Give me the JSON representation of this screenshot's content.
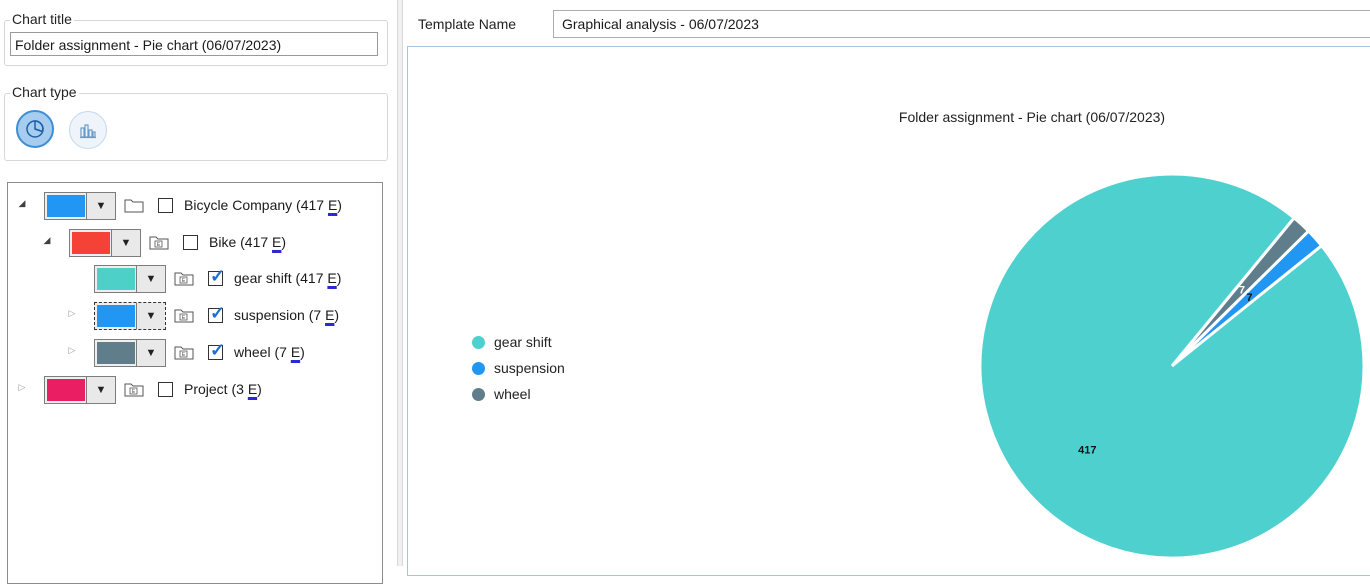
{
  "chart_title_group": {
    "label": "Chart title",
    "value": "Folder assignment - Pie chart (06/07/2023)"
  },
  "chart_type_group": {
    "label": "Chart type",
    "options": [
      {
        "name": "pie",
        "icon": "pie-chart-icon",
        "selected": true
      },
      {
        "name": "bar",
        "icon": "bar-chart-icon",
        "selected": false
      }
    ]
  },
  "tree": {
    "items": [
      {
        "label": "Bicycle Company (417 ",
        "e": "E",
        "close": ")",
        "color": "#2196F3",
        "expander": "expanded",
        "checked": false,
        "icon": "folder-icon"
      },
      {
        "label": "Bike (417 ",
        "e": "E",
        "close": ")",
        "color": "#F44336",
        "expander": "expanded",
        "checked": false,
        "icon": "folder-e-icon"
      },
      {
        "label": "gear shift (417 ",
        "e": "E",
        "close": ")",
        "color": "#4DD0C8",
        "expander": "none",
        "checked": true,
        "icon": "folder-e-icon"
      },
      {
        "label": "suspension (7 ",
        "e": "E",
        "close": ")",
        "color": "#2196F3",
        "expander": "collapsed",
        "checked": true,
        "icon": "folder-e-icon"
      },
      {
        "label": "wheel (7 ",
        "e": "E",
        "close": ")",
        "color": "#607D8B",
        "expander": "collapsed",
        "checked": true,
        "icon": "folder-e-icon"
      },
      {
        "label": "Project (3 ",
        "e": "E",
        "close": ")",
        "color": "#E91E63",
        "expander": "collapsed",
        "checked": false,
        "icon": "folder-e-icon"
      }
    ]
  },
  "template": {
    "label": "Template Name",
    "value": "Graphical analysis - 06/07/2023"
  },
  "chart_data": {
    "type": "pie",
    "title": "Folder assignment - Pie chart (06/07/2023)",
    "legend_position": "left",
    "series": [
      {
        "name": "gear shift",
        "value": 417,
        "color": "#4DD0CE"
      },
      {
        "name": "suspension",
        "value": 7,
        "color": "#2196F3"
      },
      {
        "name": "wheel",
        "value": 7,
        "color": "#607D8B"
      }
    ],
    "data_labels": [
      "417",
      "7",
      "7"
    ]
  }
}
